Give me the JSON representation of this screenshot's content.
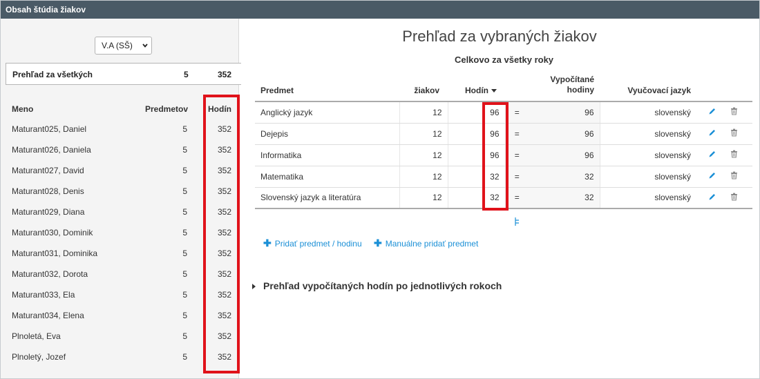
{
  "window": {
    "title": "Obsah štúdia žiakov"
  },
  "left": {
    "class_select": {
      "value": "V.A (SŠ)"
    },
    "summary": {
      "label": "Prehľad za všetkých",
      "subjects": "5",
      "hours": "352"
    },
    "headers": {
      "name": "Meno",
      "subjects": "Predmetov",
      "hours": "Hodín"
    },
    "students": [
      {
        "name": "Maturant025, Daniel",
        "subjects": "5",
        "hours": "352"
      },
      {
        "name": "Maturant026, Daniela",
        "subjects": "5",
        "hours": "352"
      },
      {
        "name": "Maturant027, David",
        "subjects": "5",
        "hours": "352"
      },
      {
        "name": "Maturant028, Denis",
        "subjects": "5",
        "hours": "352"
      },
      {
        "name": "Maturant029, Diana",
        "subjects": "5",
        "hours": "352"
      },
      {
        "name": "Maturant030, Dominik",
        "subjects": "5",
        "hours": "352"
      },
      {
        "name": "Maturant031, Dominika",
        "subjects": "5",
        "hours": "352"
      },
      {
        "name": "Maturant032, Dorota",
        "subjects": "5",
        "hours": "352"
      },
      {
        "name": "Maturant033, Ela",
        "subjects": "5",
        "hours": "352"
      },
      {
        "name": "Maturant034, Elena",
        "subjects": "5",
        "hours": "352"
      },
      {
        "name": "Plnoletá, Eva",
        "subjects": "5",
        "hours": "352"
      },
      {
        "name": "Plnoletý, Jozef",
        "subjects": "5",
        "hours": "352"
      }
    ]
  },
  "main": {
    "title": "Prehľad za vybraných žiakov",
    "subtitle": "Celkovo za všetky roky",
    "columns": {
      "subject": "Predmet",
      "students": "žiakov",
      "hours": "Hodín",
      "computed_line1": "Vypočítané",
      "computed_line2": "hodiny",
      "language": "Vyučovací jazyk"
    },
    "rows": [
      {
        "subject": "Anglický jazyk",
        "students": "12",
        "hours": "96",
        "eq": "=",
        "computed": "96",
        "language": "slovenský"
      },
      {
        "subject": "Dejepis",
        "students": "12",
        "hours": "96",
        "eq": "=",
        "computed": "96",
        "language": "slovenský"
      },
      {
        "subject": "Informatika",
        "students": "12",
        "hours": "96",
        "eq": "=",
        "computed": "96",
        "language": "slovenský"
      },
      {
        "subject": "Matematika",
        "students": "12",
        "hours": "32",
        "eq": "=",
        "computed": "32",
        "language": "slovenský"
      },
      {
        "subject": "Slovenský jazyk a literatúra",
        "students": "12",
        "hours": "32",
        "eq": "=",
        "computed": "32",
        "language": "slovenský"
      }
    ],
    "actions": {
      "add_subject_hour": "Pridať predmet / hodinu",
      "add_subject_manual": "Manuálne pridať predmet"
    },
    "section_toggle": "Prehľad vypočítaných hodín po jednotlivých rokoch"
  },
  "icons": {
    "edit": "pencil-icon",
    "delete": "trash-icon",
    "plus": "plus-icon",
    "expand": "caret-right-icon",
    "sort": "sort-desc-icon"
  },
  "colors": {
    "titlebar": "#4a5a66",
    "highlight": "#e0121a",
    "link": "#1a8fd6"
  }
}
